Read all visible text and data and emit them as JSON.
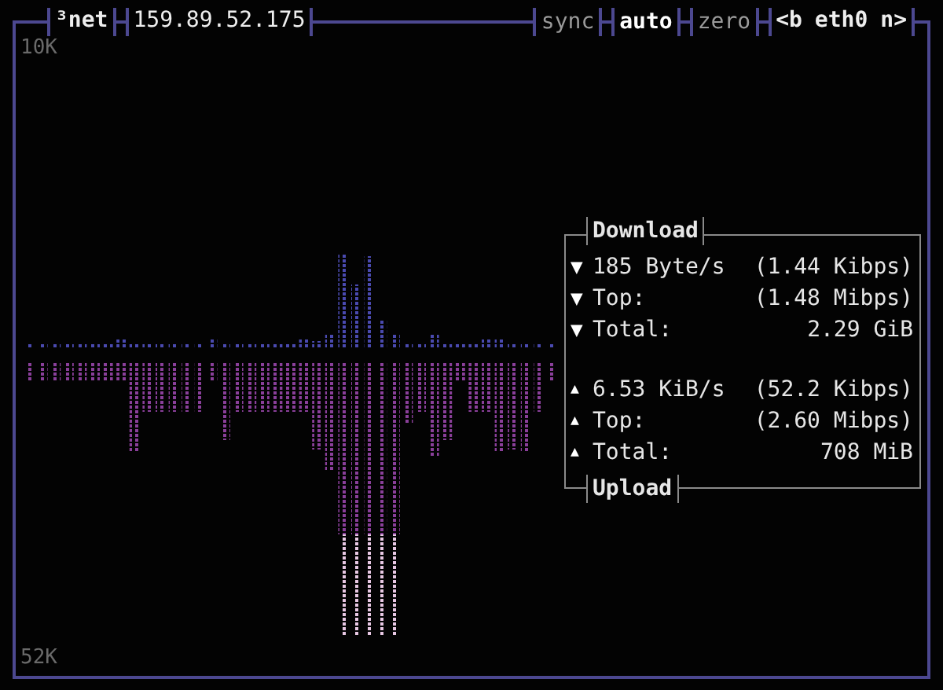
{
  "panel": {
    "title": "³net",
    "address": "159.89.52.175",
    "toggles": [
      {
        "label": "sync",
        "selected": false
      },
      {
        "label": "auto",
        "selected": true
      },
      {
        "label": "zero",
        "selected": false
      }
    ],
    "interface": {
      "prev": "<b",
      "name": "eth0",
      "next": "n>"
    }
  },
  "graph": {
    "top_label": "10K",
    "bottom_label": "52K"
  },
  "stats": [
    {
      "kind": "download",
      "title": "Download",
      "rows": [
        {
          "icon": "▼",
          "label": "185 Byte/s",
          "value": "(1.44 Kibps)"
        },
        {
          "icon": "▼",
          "label": "Top:",
          "value": "(1.48 Mibps)"
        },
        {
          "icon": "▼",
          "label": "Total:",
          "value": "2.29 GiB"
        }
      ]
    },
    {
      "kind": "upload",
      "title": "Upload",
      "rows": [
        {
          "icon": "▲",
          "label": "6.53 KiB/s",
          "value": "(52.2 Kibps)"
        },
        {
          "icon": "▲",
          "label": "Top:",
          "value": "(2.60 Mibps)"
        },
        {
          "icon": "▲",
          "label": "Total:",
          "value": "708 MiB"
        }
      ]
    }
  ]
}
